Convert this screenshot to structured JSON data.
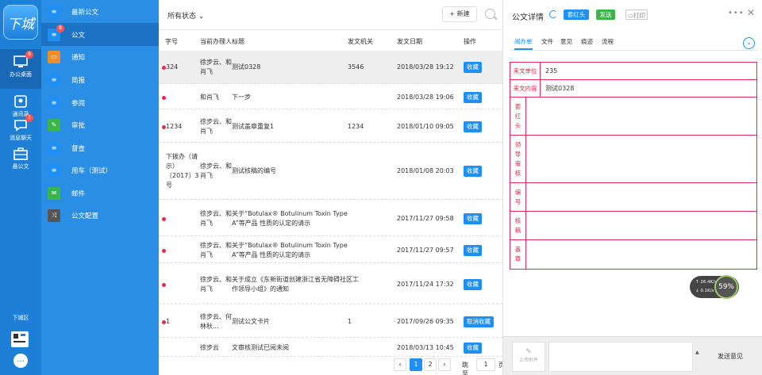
{
  "rail": {
    "logo_text": "下城",
    "items": [
      {
        "label": "办公桌面",
        "badge": "8",
        "icon": "monitor-icon"
      },
      {
        "label": "通讯录",
        "badge": "",
        "icon": "contacts-icon"
      },
      {
        "label": "消息聊天",
        "badge": "1",
        "icon": "chat-icon"
      },
      {
        "label": "悬公文",
        "badge": "",
        "icon": "briefcase-icon"
      }
    ],
    "city": "下城区",
    "more": "…"
  },
  "menu": {
    "items": [
      {
        "label": "最新公文",
        "badge": "",
        "color": "#1e8ff5",
        "glyph": "≡"
      },
      {
        "label": "公文",
        "badge": "8",
        "color": "#1e8ff5",
        "glyph": "≡"
      },
      {
        "label": "通知",
        "badge": "",
        "color": "#f08d2b",
        "glyph": "▭"
      },
      {
        "label": "简报",
        "badge": "",
        "color": "#1e8ff5",
        "glyph": "≡"
      },
      {
        "label": "参阅",
        "badge": "",
        "color": "#1e8ff5",
        "glyph": "≡"
      },
      {
        "label": "审批",
        "badge": "",
        "color": "#3bb54a",
        "glyph": "✎"
      },
      {
        "label": "督查",
        "badge": "",
        "color": "#1e8ff5",
        "glyph": "≡"
      },
      {
        "label": "用车（测试）",
        "badge": "",
        "color": "#1e8ff5",
        "glyph": "≡"
      },
      {
        "label": "邮件",
        "badge": "",
        "color": "#3bb54a",
        "glyph": "✉"
      },
      {
        "label": "公文配置",
        "badge": "",
        "color": "#555555",
        "glyph": "⤨"
      }
    ]
  },
  "list": {
    "status_filter": "所有状态 ⌄",
    "new_button": "+ 新建",
    "headers": [
      "字号",
      "当前办理人",
      "标题",
      "发文机关",
      "发文日期",
      "操作"
    ],
    "rows": [
      {
        "dot": true,
        "number": "324",
        "handler": "徐步云、和\n肖飞",
        "title": "测试0328",
        "org": "3546",
        "date": "2018/03/28 19:12",
        "action": "收藏"
      },
      {
        "dot": true,
        "number": "",
        "handler": "和肖飞",
        "title": "下一步",
        "org": "",
        "date": "2018/03/28 19:06",
        "action": "收藏"
      },
      {
        "dot": true,
        "number": "1234",
        "handler": "徐步云、和\n肖飞",
        "title": "测试盖章重复1",
        "org": "1234",
        "date": "2018/01/10 09:05",
        "action": "收藏"
      },
      {
        "dot": false,
        "number": "下拨办（请\n示）\n〔2017〕3\n号",
        "handler": "徐步云、和\n肖飞",
        "title": "测试核稿的编号",
        "org": "",
        "date": "2018/01/08 20:03",
        "action": "收藏"
      },
      {
        "dot": true,
        "number": "",
        "handler": "徐步云、和\n肖飞",
        "title": "关于“Botulax® Botulinum Toxin Type\nA”等产品 性质的认定的请示",
        "org": "",
        "date": "2017/11/27 09:58",
        "action": "收藏"
      },
      {
        "dot": true,
        "number": "",
        "handler": "徐步云、和\n肖飞",
        "title": "关于“Botulax® Botulinum Toxin Type\nA”等产品 性质的认定的请示",
        "org": "",
        "date": "2017/11/27 09:57",
        "action": "收藏"
      },
      {
        "dot": true,
        "number": "",
        "handler": "徐步云、和\n肖飞",
        "title": "关于成立《东新街道创建浙江省无障碍社区工\n作领导小组》的通知",
        "org": "",
        "date": "2017/11/24 17:32",
        "action": "收藏"
      },
      {
        "dot": true,
        "number": "1",
        "handler": "徐步云、何\n林秋...",
        "title": "测试公文卡片",
        "org": "1",
        "date": "2017/09/26 09:35",
        "action": "取消收藏"
      },
      {
        "dot": false,
        "number": "",
        "handler": "徐步云",
        "title": "文审核测试已阅未阅",
        "org": "",
        "date": "2018/03/13 10:45",
        "action": "收藏"
      }
    ],
    "pager": {
      "pages": [
        "1",
        "2"
      ],
      "prev": "‹",
      "next": "›",
      "goto_label": "跳至",
      "goto_value": "1",
      "page_suffix": "页"
    }
  },
  "detail": {
    "title": "公文详情",
    "buttons": {
      "red_head": "套红头",
      "send": "发送",
      "print": "打印"
    },
    "more": "•••",
    "close": "✕",
    "tabs": [
      "阅办单",
      "文件",
      "意见",
      "痕迹",
      "流程"
    ],
    "active_tab": "阅办单",
    "form": [
      {
        "label": "来文单位",
        "value": "235"
      },
      {
        "label": "来文内容",
        "value": "测试0328"
      },
      {
        "label": "套\n红\n头",
        "value": ""
      },
      {
        "label": "领\n导\n审\n核",
        "value": ""
      },
      {
        "label": "编\n号",
        "value": ""
      },
      {
        "label": "核\n稿",
        "value": ""
      },
      {
        "label": "盖\n章",
        "value": ""
      }
    ],
    "speed": {
      "up": "↑ 26.4K/s",
      "down": "↓ 0.1K/s",
      "percent": "59%"
    },
    "compose": {
      "upload_label": "上传附件",
      "arrow": "▲",
      "send_label": "发送意见"
    }
  },
  "colors": {
    "rail": "#1e7fd6",
    "menu": "#2a8ee5",
    "accent": "#1e8ff5",
    "form_border": "#e5294b",
    "send_green": "#3bb54a"
  }
}
